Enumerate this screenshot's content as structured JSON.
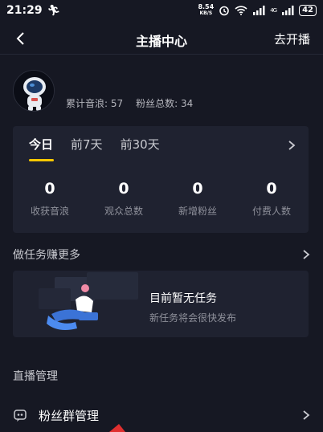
{
  "status": {
    "time": "21:29",
    "net_speed_value": "8.54",
    "net_speed_unit": "KB/S",
    "battery": "42",
    "signal1": "4G"
  },
  "nav": {
    "title": "主播中心",
    "action": "去开播"
  },
  "profile": {
    "total_sound_waves": "累计音浪: 57",
    "total_fans": "粉丝总数: 34"
  },
  "stats_card": {
    "tabs": [
      "今日",
      "前7天",
      "前30天"
    ],
    "metrics": [
      {
        "value": "0",
        "label": "收获音浪"
      },
      {
        "value": "0",
        "label": "观众总数"
      },
      {
        "value": "0",
        "label": "新增粉丝"
      },
      {
        "value": "0",
        "label": "付费人数"
      }
    ]
  },
  "tasks": {
    "section_title": "做任务赚更多",
    "empty_title": "目前暂无任务",
    "empty_subtitle": "新任务将会很快发布"
  },
  "live_manage": {
    "section_title": "直播管理",
    "items": [
      {
        "label": "粉丝群管理",
        "icon": "fan-group-icon"
      }
    ]
  },
  "colors": {
    "background": "#161823",
    "card": "#1f2230",
    "accent": "#f9c800"
  }
}
